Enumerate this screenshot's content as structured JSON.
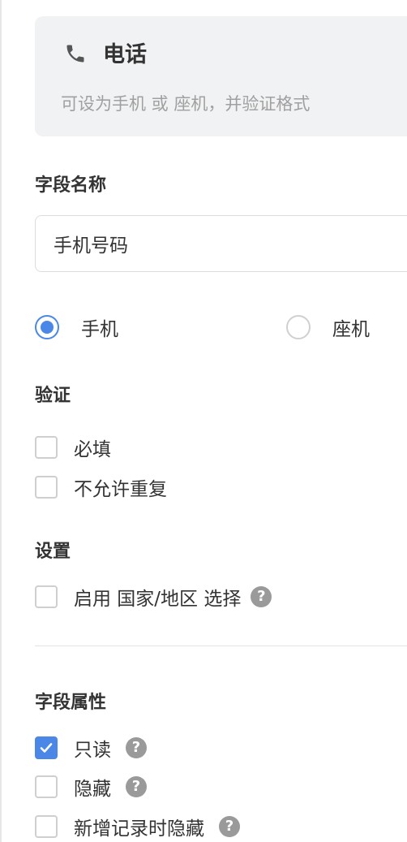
{
  "header_card": {
    "title": "电话",
    "description": "可设为手机 或 座机，并验证格式"
  },
  "field_name": {
    "label": "字段名称",
    "value": "手机号码"
  },
  "phone_type": {
    "options": [
      {
        "label": "手机",
        "selected": true
      },
      {
        "label": "座机",
        "selected": false
      }
    ]
  },
  "validation": {
    "label": "验证",
    "options": [
      {
        "label": "必填",
        "checked": false
      },
      {
        "label": "不允许重复",
        "checked": false
      }
    ]
  },
  "settings": {
    "label": "设置",
    "options": [
      {
        "label": "启用 国家/地区 选择",
        "checked": false
      }
    ]
  },
  "field_attributes": {
    "label": "字段属性",
    "options": [
      {
        "label": "只读",
        "checked": true
      },
      {
        "label": "隐藏",
        "checked": false
      },
      {
        "label": "新增记录时隐藏",
        "checked": false
      }
    ]
  },
  "help_glyph": "?",
  "colors": {
    "accent": "#4a87e6",
    "card_bg": "#f1f2f3",
    "muted_text": "#a0a0a0",
    "help_icon_bg": "#9a9a9a"
  }
}
